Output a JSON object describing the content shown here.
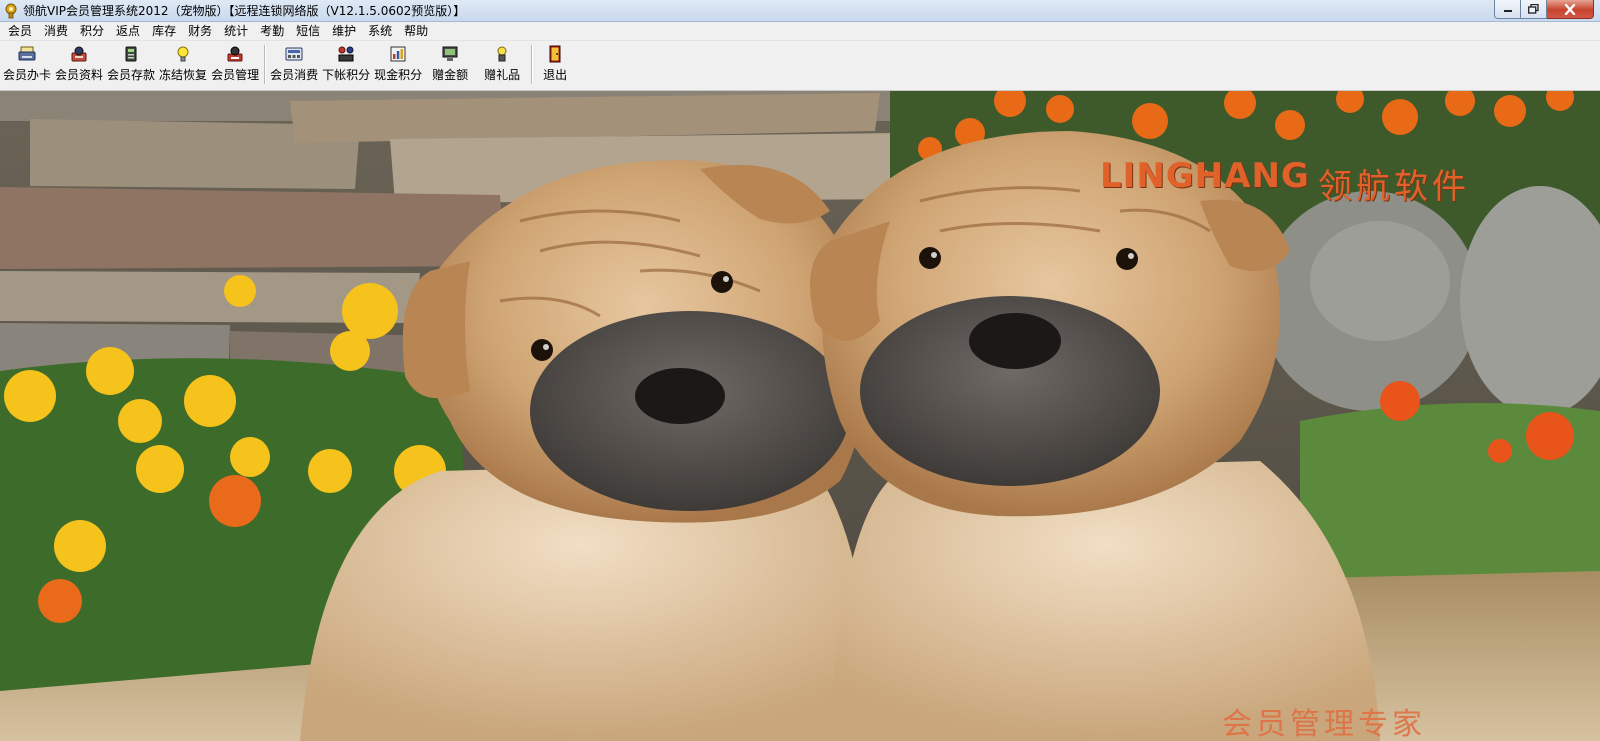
{
  "window": {
    "title": "领航VIP会员管理系统2012（宠物版）【远程连锁网络版（V12.1.5.0602预览版）】",
    "app_icon": "gold-key-icon",
    "controls": [
      "minimize-icon",
      "maximize-icon",
      "close-icon"
    ]
  },
  "menu": {
    "items": [
      {
        "label": "会员"
      },
      {
        "label": "消费"
      },
      {
        "label": "积分"
      },
      {
        "label": "返点"
      },
      {
        "label": "库存"
      },
      {
        "label": "财务"
      },
      {
        "label": "统计"
      },
      {
        "label": "考勤"
      },
      {
        "label": "短信"
      },
      {
        "label": "维护"
      },
      {
        "label": "系统"
      },
      {
        "label": "帮助"
      }
    ]
  },
  "toolbar": {
    "buttons": [
      {
        "label": "会员办卡",
        "icon": "card-printer-icon"
      },
      {
        "label": "会员资料",
        "icon": "member-profile-icon"
      },
      {
        "label": "会员存款",
        "icon": "deposit-icon"
      },
      {
        "label": "冻结恢复",
        "icon": "lightbulb-icon"
      },
      {
        "label": "会员管理",
        "icon": "member-manage-icon"
      },
      {
        "label": "会员消费",
        "icon": "register-icon"
      },
      {
        "label": "下帐积分",
        "icon": "points-transfer-icon"
      },
      {
        "label": "现金积分",
        "icon": "cash-points-icon"
      },
      {
        "label": "赠金额",
        "icon": "monitor-icon"
      },
      {
        "label": "赠礼品",
        "icon": "gift-icon"
      },
      {
        "label": "退出",
        "icon": "exit-door-icon"
      }
    ]
  },
  "splash": {
    "brand_en": "LINGHANG",
    "brand_cn": "领航软件",
    "slogan": "会员管理专家"
  },
  "colors": {
    "brand": "#e0622a",
    "titlebar": "#c9d9ee",
    "menubar": "#f0f0f0"
  }
}
